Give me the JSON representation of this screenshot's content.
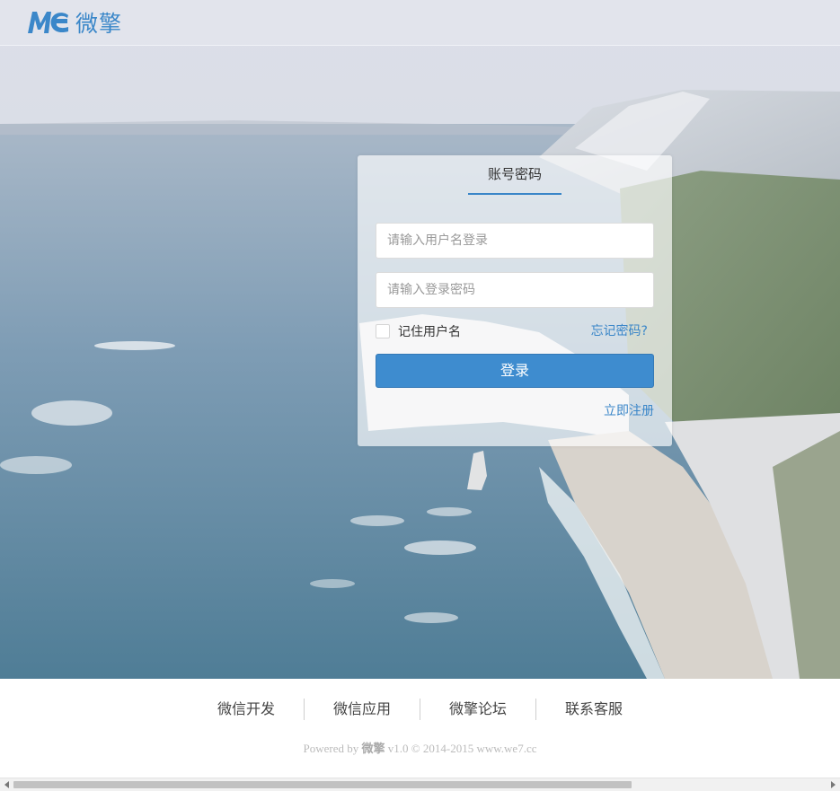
{
  "header": {
    "logo_text": "微擎",
    "brand_color": "#3b87c9"
  },
  "login": {
    "tab_label": "账号密码",
    "username_placeholder": "请输入用户名登录",
    "password_placeholder": "请输入登录密码",
    "remember_label": "记住用户名",
    "forgot_link": "忘记密码?",
    "submit_label": "登录",
    "register_link": "立即注册",
    "accent_color": "#3e8ccf"
  },
  "footer": {
    "links": [
      "微信开发",
      "微信应用",
      "微擎论坛",
      "联系客服"
    ],
    "copyright_prefix": "Powered by",
    "copyright_brand": "微擎",
    "copyright_suffix": "v1.0 © 2014-2015 www.we7.cc"
  },
  "icons": {
    "logo": "we7-logo-icon",
    "scroll_left": "chevron-left-icon",
    "scroll_right": "chevron-right-icon"
  }
}
